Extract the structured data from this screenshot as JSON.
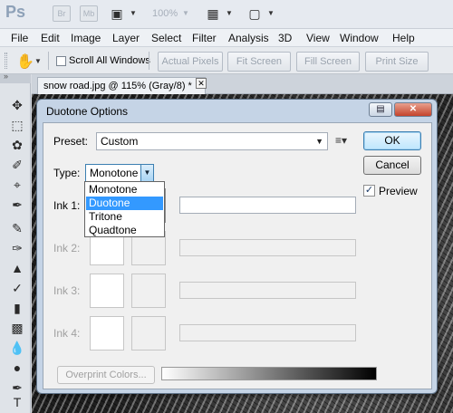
{
  "app": {
    "logo": "Ps",
    "bridge_label": "Br",
    "minibridge_label": "Mb",
    "zoom_value": "100%"
  },
  "menu": [
    "File",
    "Edit",
    "Image",
    "Layer",
    "Select",
    "Filter",
    "Analysis",
    "3D",
    "View",
    "Window",
    "Help"
  ],
  "options_bar": {
    "scroll_all_windows": "Scroll All Windows",
    "scroll_all_checked": false,
    "buttons": [
      "Actual Pixels",
      "Fit Screen",
      "Fill Screen",
      "Print Size"
    ]
  },
  "document": {
    "tab_title": "snow road.jpg @ 115% (Gray/8) *",
    "close_glyph": "✕"
  },
  "dialog": {
    "title": "Duotone Options",
    "preset_label": "Preset:",
    "preset_value": "Custom",
    "type_label": "Type:",
    "type_value": "Monotone",
    "ok_label": "OK",
    "cancel_label": "Cancel",
    "preview_label": "Preview",
    "preview_checked": true,
    "inks": [
      {
        "label": "Ink 1:",
        "enabled": true
      },
      {
        "label": "Ink 2:",
        "enabled": false
      },
      {
        "label": "Ink 3:",
        "enabled": false
      },
      {
        "label": "Ink 4:",
        "enabled": false
      }
    ],
    "overprint_label": "Overprint Colors...",
    "type_options": [
      "Monotone",
      "Duotone",
      "Tritone",
      "Quadtone"
    ],
    "type_highlighted": "Duotone"
  },
  "icons": {
    "hand": "hand-icon",
    "preset_menu": "list-menu-icon",
    "help": "dialog-help-icon",
    "close": "close-icon"
  }
}
